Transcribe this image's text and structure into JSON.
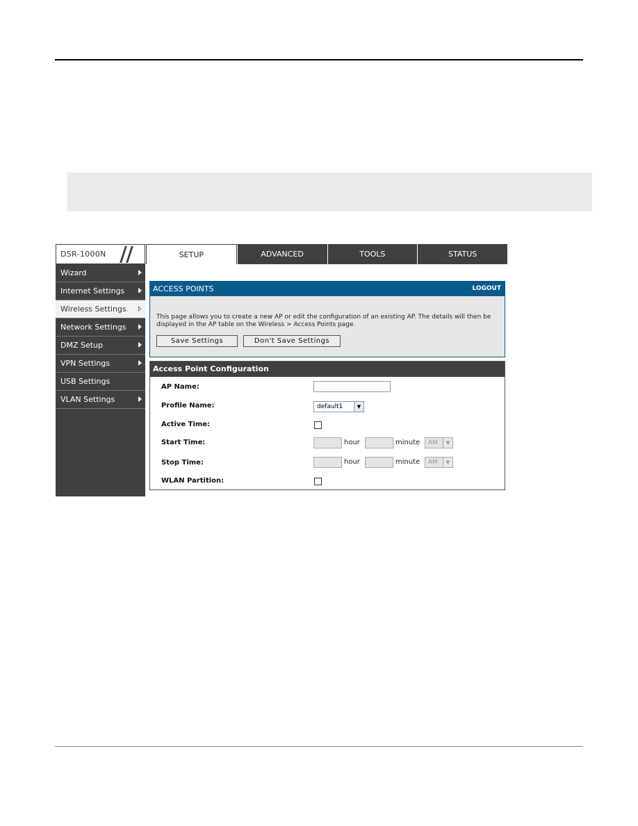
{
  "logo": "DSR-1000N",
  "tabs": [
    {
      "label": "SETUP",
      "active": true
    },
    {
      "label": "ADVANCED",
      "active": false
    },
    {
      "label": "TOOLS",
      "active": false
    },
    {
      "label": "STATUS",
      "active": false
    }
  ],
  "sidebar": [
    {
      "label": "Wizard"
    },
    {
      "label": "Internet Settings"
    },
    {
      "label": "Wireless Settings",
      "active": true
    },
    {
      "label": "Network Settings"
    },
    {
      "label": "DMZ Setup"
    },
    {
      "label": "VPN Settings"
    },
    {
      "label": "USB Settings"
    },
    {
      "label": "VLAN Settings"
    }
  ],
  "access_points": {
    "title": "ACCESS POINTS",
    "logout": "LOGOUT",
    "description": "This page allows you to create a new AP or edit the configuration of an existing AP. The details will then be displayed in the AP table on the Wireless > Access Points page.",
    "save_button": "Save Settings",
    "dont_save_button": "Don't Save Settings"
  },
  "config": {
    "title": "Access Point Configuration",
    "ap_name_label": "AP Name:",
    "ap_name_value": "",
    "profile_name_label": "Profile Name:",
    "profile_name_value": "default1",
    "active_time_label": "Active Time:",
    "start_time_label": "Start Time:",
    "stop_time_label": "Stop Time:",
    "wlan_partition_label": "WLAN Partition:",
    "hour_unit": "hour",
    "minute_unit": "minute",
    "ampm_value": "AM"
  },
  "colors": {
    "header_blue": "#0a5a8c",
    "dark_gray": "#404040"
  }
}
